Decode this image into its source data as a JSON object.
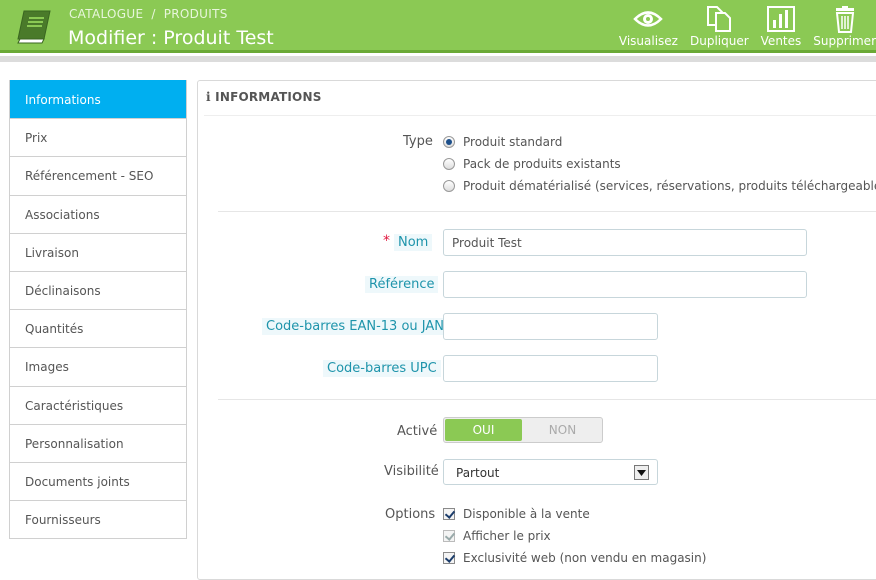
{
  "header": {
    "breadcrumb": [
      "CATALOGUE",
      "PRODUITS"
    ],
    "breadcrumb_sep": "/",
    "title": "Modifier : Produit Test",
    "toolbar": [
      {
        "label": "Visualisez",
        "icon": "eye-icon"
      },
      {
        "label": "Dupliquer",
        "icon": "duplicate-icon"
      },
      {
        "label": "Ventes",
        "icon": "bar-chart-icon"
      },
      {
        "label": "Supprimer",
        "icon": "trash-icon"
      }
    ]
  },
  "sidebar": {
    "items": [
      {
        "label": "Informations",
        "active": true
      },
      {
        "label": "Prix"
      },
      {
        "label": "Référencement - SEO"
      },
      {
        "label": "Associations"
      },
      {
        "label": "Livraison"
      },
      {
        "label": "Déclinaisons"
      },
      {
        "label": "Quantités"
      },
      {
        "label": "Images"
      },
      {
        "label": "Caractéristiques"
      },
      {
        "label": "Personnalisation"
      },
      {
        "label": "Documents joints"
      },
      {
        "label": "Fournisseurs"
      }
    ]
  },
  "panel": {
    "heading_icon": "i",
    "heading": "INFORMATIONS",
    "type": {
      "label": "Type",
      "options": [
        {
          "label": "Produit standard",
          "selected": true
        },
        {
          "label": "Pack de produits existants",
          "selected": false
        },
        {
          "label": "Produit dématérialisé (services, réservations, produits téléchargeables, etc.)",
          "selected": false
        }
      ]
    },
    "required_mark": "*",
    "nom": {
      "label": "Nom",
      "value": "Produit Test"
    },
    "reference": {
      "label": "Référence",
      "value": ""
    },
    "ean13": {
      "label": "Code-barres EAN-13 ou JAN",
      "value": ""
    },
    "upc": {
      "label": "Code-barres UPC",
      "value": ""
    },
    "active": {
      "label": "Activé",
      "on_label": "OUI",
      "off_label": "NON",
      "value": "OUI"
    },
    "visibility": {
      "label": "Visibilité",
      "value": "Partout"
    },
    "options": {
      "label": "Options",
      "items": [
        {
          "label": "Disponible à la vente",
          "checked": true,
          "disabled": false
        },
        {
          "label": "Afficher le prix",
          "checked": true,
          "disabled": true
        },
        {
          "label": "Exclusivité web (non vendu en magasin)",
          "checked": true,
          "disabled": false
        }
      ]
    }
  },
  "colors": {
    "header_green": "#8bc954",
    "active_tab": "#00aff0",
    "link_blue": "#1e94ab"
  }
}
